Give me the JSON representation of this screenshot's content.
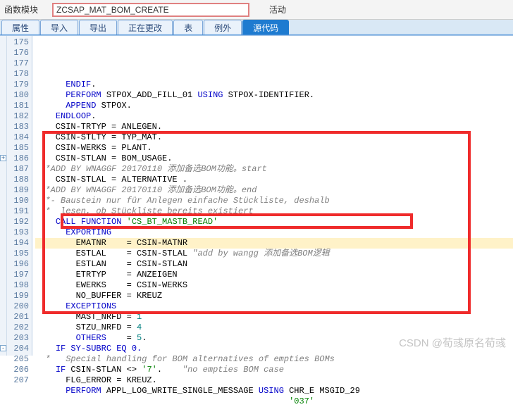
{
  "header": {
    "label_module": "函数模块",
    "module_name": "ZCSAP_MAT_BOM_CREATE",
    "status_label": "活动"
  },
  "tabs": [
    {
      "label": "属性",
      "active": false
    },
    {
      "label": "导入",
      "active": false
    },
    {
      "label": "导出",
      "active": false
    },
    {
      "label": "正在更改",
      "active": false
    },
    {
      "label": "表",
      "active": false
    },
    {
      "label": "例外",
      "active": false
    },
    {
      "label": "源代码",
      "active": true
    }
  ],
  "line_start": 175,
  "line_end": 207,
  "fold_marks": [
    {
      "line": 186,
      "sym": "+"
    },
    {
      "line": 204,
      "sym": "-"
    }
  ],
  "code_lines": [
    {
      "tokens": [
        {
          "t": "      ",
          "c": ""
        },
        {
          "t": "ENDIF",
          "c": "kw"
        },
        {
          "t": ".",
          "c": ""
        }
      ]
    },
    {
      "tokens": [
        {
          "t": "      ",
          "c": ""
        },
        {
          "t": "PERFORM",
          "c": "kw"
        },
        {
          "t": " STPOX_ADD_FILL_01 ",
          "c": "id"
        },
        {
          "t": "USING",
          "c": "kw"
        },
        {
          "t": " STPOX-IDENTIFIER.",
          "c": "id"
        }
      ]
    },
    {
      "tokens": [
        {
          "t": "      ",
          "c": ""
        },
        {
          "t": "APPEND",
          "c": "kw"
        },
        {
          "t": " STPOX.",
          "c": "id"
        }
      ]
    },
    {
      "tokens": [
        {
          "t": "    ",
          "c": ""
        },
        {
          "t": "ENDLOOP",
          "c": "kw"
        },
        {
          "t": ".",
          "c": ""
        }
      ]
    },
    {
      "tokens": [
        {
          "t": "",
          "c": ""
        }
      ]
    },
    {
      "tokens": [
        {
          "t": "    CSIN-TRTYP = ANLEGEN.",
          "c": "id"
        }
      ]
    },
    {
      "tokens": [
        {
          "t": "    CSIN-STLTY = TYP_MAT.",
          "c": "id"
        }
      ]
    },
    {
      "tokens": [
        {
          "t": "    CSIN-WERKS = PLANT.",
          "c": "id"
        }
      ]
    },
    {
      "tokens": [
        {
          "t": "    CSIN-STLAN = BOM_USAGE.",
          "c": "id"
        }
      ]
    },
    {
      "tokens": [
        {
          "t": "  *ADD BY WNAGGF 20170110 添加备选BOM功能。start",
          "c": "cm"
        }
      ]
    },
    {
      "tokens": [
        {
          "t": "    CSIN-STLAL = ALTERNATIVE .",
          "c": "id"
        }
      ]
    },
    {
      "tokens": [
        {
          "t": "  *ADD BY WNAGGF 20170110 添加备选BOM功能。end",
          "c": "cm"
        }
      ]
    },
    {
      "tokens": [
        {
          "t": "  *- Baustein nur für Anlegen einfache Stückliste, deshalb",
          "c": "cm"
        }
      ]
    },
    {
      "tokens": [
        {
          "t": "  *  lesen, ob Stückliste bereits existiert",
          "c": "cm"
        }
      ]
    },
    {
      "tokens": [
        {
          "t": "    ",
          "c": ""
        },
        {
          "t": "CALL FUNCTION",
          "c": "kw"
        },
        {
          "t": " ",
          "c": ""
        },
        {
          "t": "'CS_BT_MASTB_READ'",
          "c": "str"
        }
      ]
    },
    {
      "tokens": [
        {
          "t": "      ",
          "c": ""
        },
        {
          "t": "EXPORTING",
          "c": "kw2"
        }
      ]
    },
    {
      "tokens": [
        {
          "t": "        EMATNR    = CSIN-MATNR",
          "c": "id"
        }
      ],
      "hl": true
    },
    {
      "tokens": [
        {
          "t": "        ESTLAL    = CSIN-STLAL ",
          "c": "id"
        },
        {
          "t": "\"add by wangg 添加备选BOM逻辑",
          "c": "cm"
        }
      ]
    },
    {
      "tokens": [
        {
          "t": "        ESTLAN    = CSIN-STLAN",
          "c": "id"
        }
      ]
    },
    {
      "tokens": [
        {
          "t": "        ETRTYP    = ANZEIGEN",
          "c": "id"
        }
      ]
    },
    {
      "tokens": [
        {
          "t": "        EWERKS    = CSIN-WERKS",
          "c": "id"
        }
      ]
    },
    {
      "tokens": [
        {
          "t": "        NO_BUFFER = KREUZ",
          "c": "id"
        }
      ]
    },
    {
      "tokens": [
        {
          "t": "      ",
          "c": ""
        },
        {
          "t": "EXCEPTIONS",
          "c": "kw2"
        }
      ]
    },
    {
      "tokens": [
        {
          "t": "        MAST_NRFD = ",
          "c": "id"
        },
        {
          "t": "1",
          "c": "num"
        }
      ]
    },
    {
      "tokens": [
        {
          "t": "        STZU_NRFD = ",
          "c": "id"
        },
        {
          "t": "4",
          "c": "num"
        }
      ]
    },
    {
      "tokens": [
        {
          "t": "        ",
          "c": ""
        },
        {
          "t": "OTHERS",
          "c": "kw"
        },
        {
          "t": "    = ",
          "c": "id"
        },
        {
          "t": "5",
          "c": "num"
        },
        {
          "t": ".",
          "c": ""
        }
      ]
    },
    {
      "tokens": [
        {
          "t": "",
          "c": ""
        }
      ]
    },
    {
      "tokens": [
        {
          "t": "    ",
          "c": ""
        },
        {
          "t": "IF SY-SUBRC EQ 0.",
          "c": "kw"
        }
      ]
    },
    {
      "tokens": [
        {
          "t": "  *   Special handling for BOM alternatives of empties BOMs",
          "c": "cm"
        }
      ]
    },
    {
      "tokens": [
        {
          "t": "    ",
          "c": ""
        },
        {
          "t": "IF",
          "c": "kw"
        },
        {
          "t": " CSIN-STLAN <> ",
          "c": "id"
        },
        {
          "t": "'7'",
          "c": "str"
        },
        {
          "t": ".    ",
          "c": ""
        },
        {
          "t": "\"no empties BOM case",
          "c": "cm"
        }
      ]
    },
    {
      "tokens": [
        {
          "t": "      FLG_ERROR = KREUZ.",
          "c": "id"
        }
      ]
    },
    {
      "tokens": [
        {
          "t": "      ",
          "c": ""
        },
        {
          "t": "PERFORM",
          "c": "kw"
        },
        {
          "t": " APPL_LOG_WRITE_SINGLE_MESSAGE ",
          "c": "id"
        },
        {
          "t": "USING",
          "c": "kw"
        },
        {
          "t": " CHR_E MSGID_29",
          "c": "id"
        }
      ]
    },
    {
      "tokens": [
        {
          "t": "                                                  ",
          "c": ""
        },
        {
          "t": "'037'",
          "c": "str"
        }
      ]
    }
  ],
  "watermark": "CSDN @荀彧原名荀彧"
}
